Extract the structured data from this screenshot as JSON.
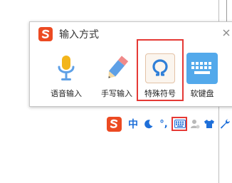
{
  "popup": {
    "title": "输入方式",
    "tools": [
      {
        "label": "语音输入",
        "icon": "microphone-icon"
      },
      {
        "label": "手写输入",
        "icon": "pencil-icon"
      },
      {
        "label": "特殊符号",
        "icon": "omega-icon",
        "highlighted": true
      },
      {
        "label": "软键盘",
        "icon": "keyboard-icon"
      }
    ],
    "close_icon": "close-icon"
  },
  "statusbar": {
    "logo_icon": "sogou-logo-icon",
    "language": "中",
    "punctuation": "°,",
    "icons": [
      "half-moon-icon",
      "keyboard-icon",
      "user-icon",
      "shirt-icon",
      "wrench-icon"
    ],
    "highlighted": "keyboard-icon"
  },
  "colors": {
    "brand": "#ec4a22",
    "accent": "#1e6fd9",
    "highlight": "#e53935",
    "keyboard_tile": "#53a9eb"
  }
}
